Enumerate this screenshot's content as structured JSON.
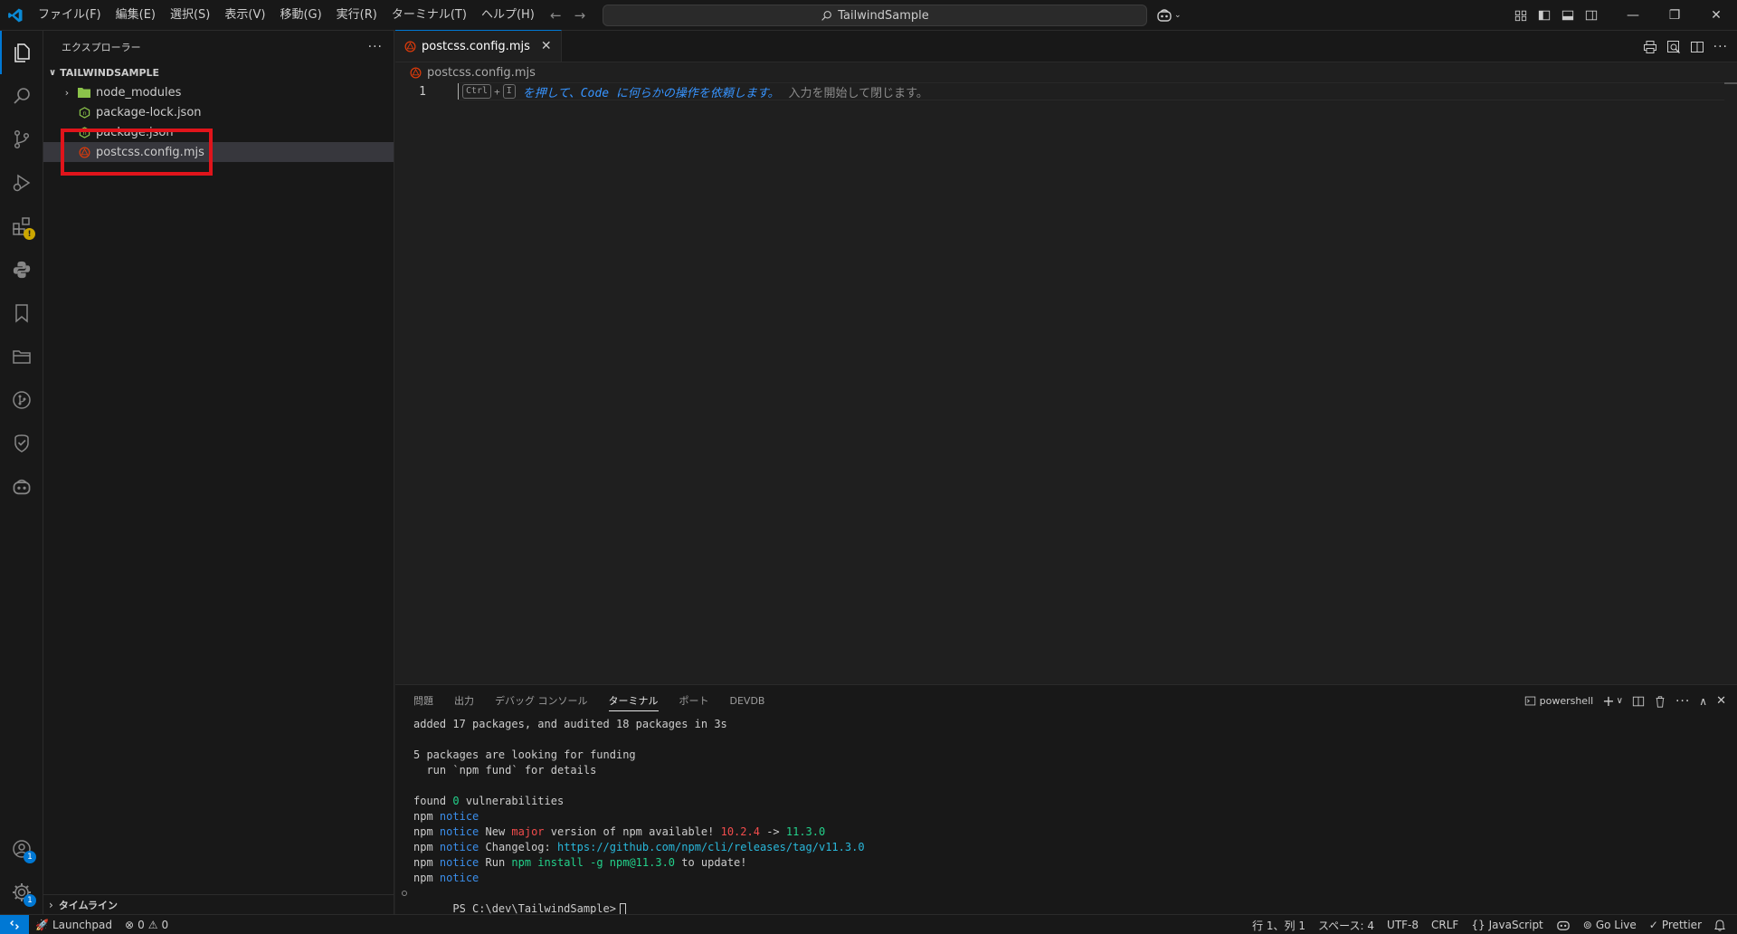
{
  "titlebar": {
    "menus": [
      "ファイル(F)",
      "編集(E)",
      "選択(S)",
      "表示(V)",
      "移動(G)",
      "実行(R)",
      "ターミナル(T)",
      "ヘルプ(H)"
    ],
    "search_text": "TailwindSample"
  },
  "activitybar": {
    "items": [
      "explorer-icon",
      "search-icon",
      "source-control-icon",
      "run-debug-icon",
      "extensions-icon",
      "python-icon",
      "bookmark-icon",
      "folder-icon",
      "git-graph-icon",
      "testing-icon",
      "copilot-icon"
    ],
    "accounts_badge": "1",
    "settings_badge": "1"
  },
  "sidebar": {
    "title": "エクスプローラー",
    "folder_name": "TAILWINDSAMPLE",
    "items": [
      {
        "label": "node_modules",
        "type": "folder"
      },
      {
        "label": "package-lock.json",
        "type": "json"
      },
      {
        "label": "package.json",
        "type": "json"
      },
      {
        "label": "postcss.config.mjs",
        "type": "postcss"
      }
    ],
    "timeline_label": "タイムライン"
  },
  "editor": {
    "tab_label": "postcss.config.mjs",
    "breadcrumb": "postcss.config.mjs",
    "line_number": "1",
    "hint": {
      "key1": "Ctrl",
      "plus": "+",
      "key2": "I",
      "link_text": "を押して、Code に何らかの操作を依頼します。",
      "rest_text": "入力を開始して閉じます。"
    }
  },
  "panel": {
    "tabs": [
      "問題",
      "出力",
      "デバッグ コンソール",
      "ターミナル",
      "ポート",
      "DEVDB"
    ],
    "active_tab": "ターミナル",
    "terminal_name": "powershell",
    "terminal": {
      "l1": "added 17 packages, and audited 18 packages in 3s",
      "l3": "5 packages are looking for funding",
      "l4": "  run `npm fund` for details",
      "l6a": "found ",
      "l6b": "0",
      "l6c": " vulnerabilities",
      "npm": "npm",
      "notice": "notice",
      "l8a": " New ",
      "l8b": "major",
      "l8c": " version of npm available! ",
      "l8d": "10.2.4",
      "l8e": " -> ",
      "l8f": "11.3.0",
      "l9a": " Changelog: ",
      "l9b": "https://github.com/npm/cli/releases/tag/v11.3.0",
      "l10a": " Run ",
      "l10b": "npm install -g npm@11.3.0",
      "l10c": " to update!",
      "prompt": "PS C:\\dev\\TailwindSample>"
    }
  },
  "statusbar": {
    "launchpad": "Launchpad",
    "errors": "0",
    "warnings": "0",
    "position": "行 1、列 1",
    "spaces": "スペース: 4",
    "encoding": "UTF-8",
    "eol": "CRLF",
    "language": "JavaScript",
    "golive": "Go Live",
    "prettier": "Prettier"
  },
  "colors": {
    "accent": "#0078d4",
    "highlight_box": "#e0141b",
    "postcss_icon": "#dd3a0a",
    "json_icon": "#cbcb41",
    "folder_icon": "#8bc34a"
  }
}
